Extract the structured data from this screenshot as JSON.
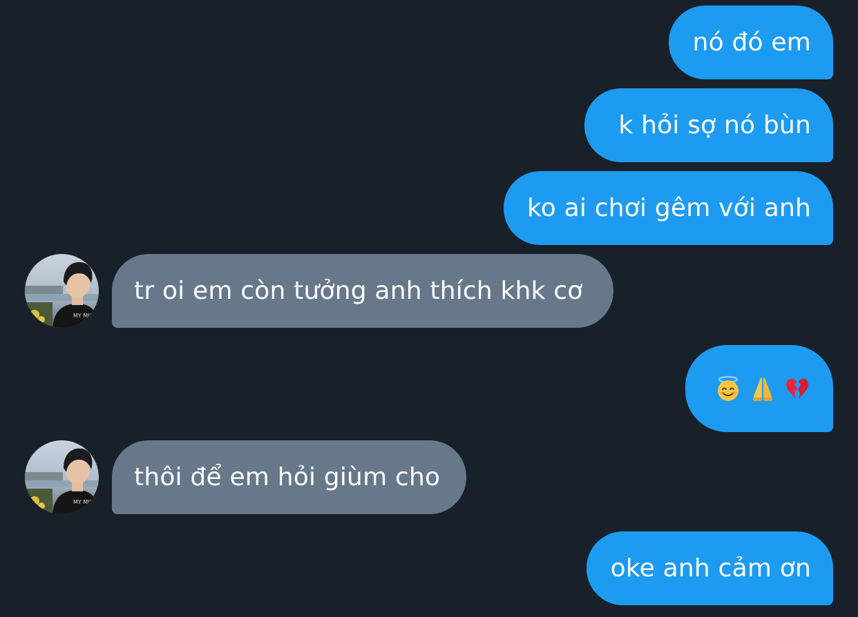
{
  "messages": [
    {
      "side": "out",
      "text": "nó đó em"
    },
    {
      "side": "out",
      "text": "k hỏi sợ nó bùn"
    },
    {
      "side": "out",
      "text": "ko ai chơi gêm với anh"
    },
    {
      "side": "in",
      "text": "tr oi em còn tưởng anh thích khk cơ"
    },
    {
      "side": "out",
      "text": "😇 🙏 💔",
      "emoji": [
        "smiling-face-with-halo-icon",
        "folded-hands-icon",
        "broken-heart-icon"
      ]
    },
    {
      "side": "in",
      "text": "thôi để em hỏi giùm cho"
    },
    {
      "side": "out",
      "text": "oke anh cảm ơn"
    }
  ],
  "colors": {
    "background": "#18202a",
    "outgoing_bubble": "#1d9bf0",
    "incoming_bubble": "#66788a",
    "text": "#ffffff"
  }
}
